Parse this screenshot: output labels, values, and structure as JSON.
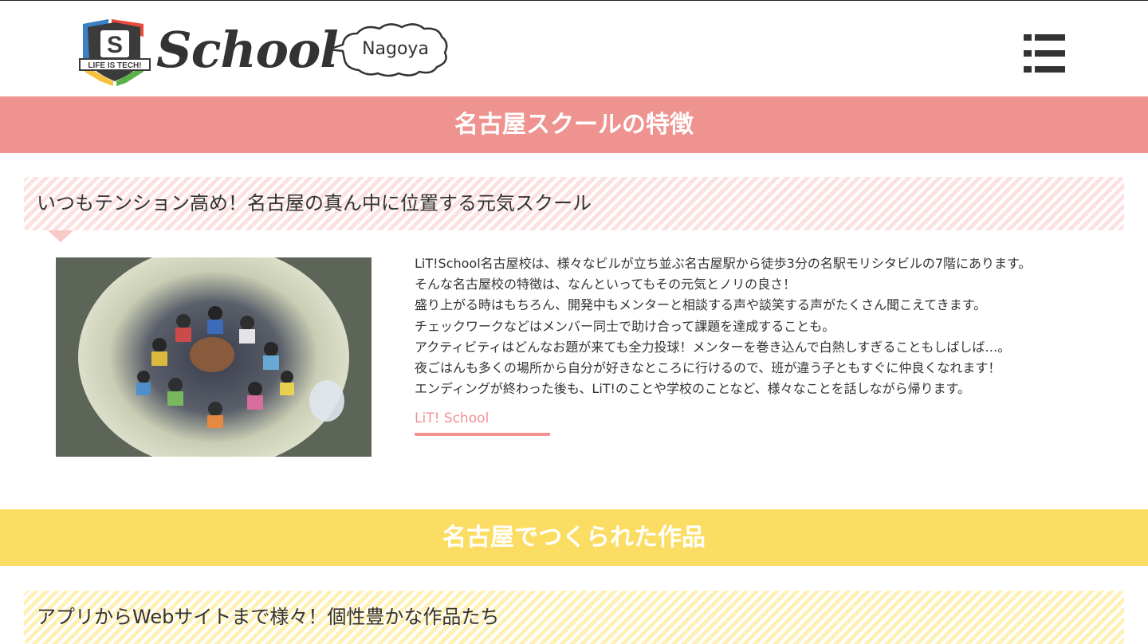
{
  "header": {
    "logo_badge_letter": "S",
    "logo_ribbon_text": "LIFE IS TECH!",
    "logo_wordmark": "School",
    "city_label": "Nagoya"
  },
  "sections": [
    {
      "bar_title": "名古屋スクールの特徴",
      "heading": "いつもテンション高め！名古屋の真ん中に位置する元気スクール",
      "paragraphs": [
        "LiT!School名古屋校は、様々なビルが立ち並ぶ名古屋駅から徒歩3分の名駅モリシタビルの7階にあります。",
        "そんな名古屋校の特徴は、なんといってもその元気とノリの良さ！",
        "盛り上がる時はもちろん、開発中もメンターと相談する声や談笑する声がたくさん聞こえてきます。",
        "チェックワークなどはメンバー同士で助け合って課題を達成することも。",
        "アクティビティはどんなお題が来ても全力投球！メンターを巻き込んで白熱しすぎることもしばしば…。",
        "夜ごはんも多くの場所から自分が好きなところに行けるので、班が違う子ともすぐに仲良くなれます！",
        "エンディングが終わった後も、LiT!のことや学校のことなど、様々なことを話しながら帰ります。"
      ],
      "link_label": "LiT! School"
    },
    {
      "bar_title": "名古屋でつくられた作品",
      "heading": "アプリからWebサイトまで様々！個性豊かな作品たち"
    }
  ],
  "colors": {
    "pink": "#ee9390",
    "yellow": "#fcdd63",
    "text": "#333333"
  },
  "icons": {
    "menu": "hamburger-list-icon",
    "badge": "shield-logo-icon",
    "cloud": "cloud-icon"
  }
}
